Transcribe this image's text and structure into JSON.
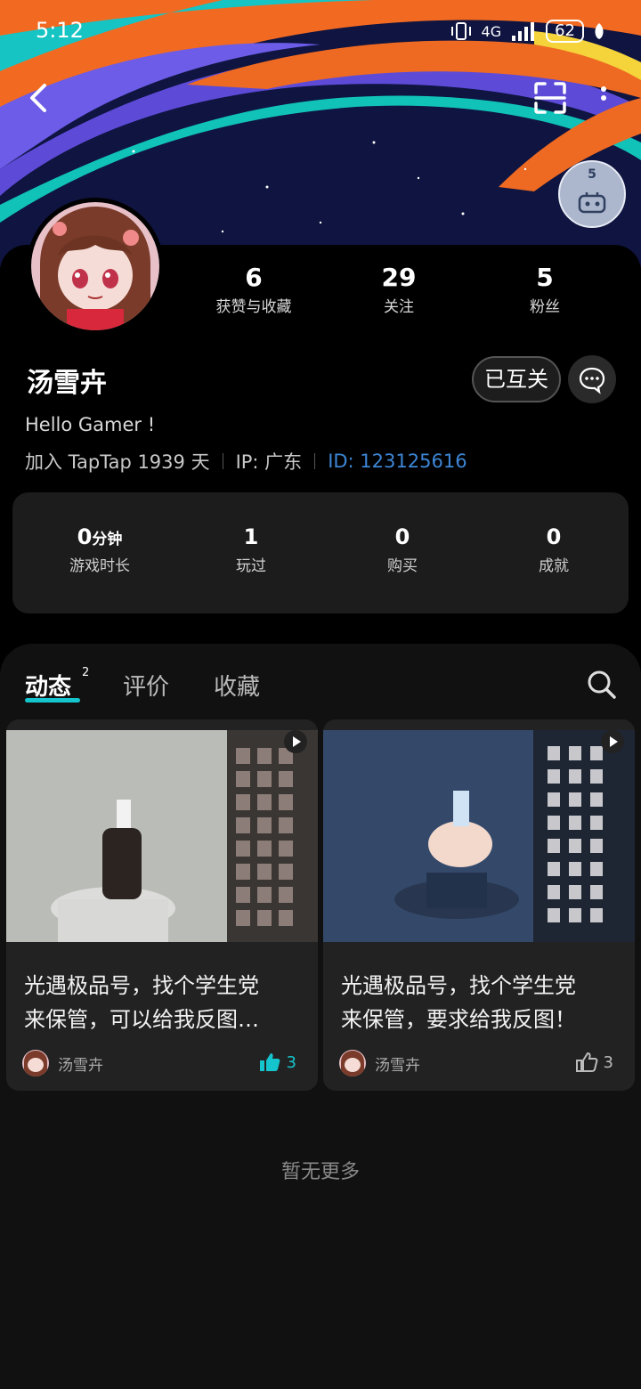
{
  "status_bar": {
    "time": "5:12",
    "network": "4G",
    "battery": "62"
  },
  "profile": {
    "name": "汤雪卉",
    "stats": [
      {
        "value": "6",
        "label": "获赞与收藏"
      },
      {
        "value": "29",
        "label": "关注"
      },
      {
        "value": "5",
        "label": "粉丝"
      }
    ],
    "mutual_button": "已互关",
    "bio": "Hello Gamer !",
    "joined": "加入 TapTap 1939 天",
    "ip": "IP: 广东",
    "id": "ID: 123125616",
    "badge_number": "5"
  },
  "game_stats": [
    {
      "value": "0",
      "unit": "分钟",
      "label": "游戏时长"
    },
    {
      "value": "1",
      "unit": "",
      "label": "玩过"
    },
    {
      "value": "0",
      "unit": "",
      "label": "购买"
    },
    {
      "value": "0",
      "unit": "",
      "label": "成就"
    }
  ],
  "tabs": [
    {
      "label": "动态",
      "badge": "2"
    },
    {
      "label": "评价"
    },
    {
      "label": "收藏"
    }
  ],
  "posts": [
    {
      "title_line1": "光遇极品号，找个学生党",
      "title_line2": "来保管，可以给我反图…",
      "author": "汤雪卉",
      "likes": "3",
      "liked": true
    },
    {
      "title_line1": "光遇极品号，找个学生党",
      "title_line2": "来保管，要求给我反图！",
      "author": "汤雪卉",
      "likes": "3",
      "liked": false
    }
  ],
  "footer": {
    "no_more": "暂无更多"
  },
  "colors": {
    "accent": "#15c5ce",
    "id_link": "#3d86d6",
    "card_bg": "#222222"
  }
}
